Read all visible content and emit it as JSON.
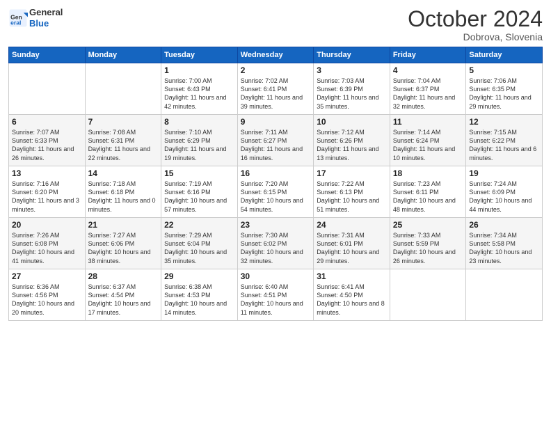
{
  "header": {
    "logo_general": "General",
    "logo_blue": "Blue",
    "month_title": "October 2024",
    "location": "Dobrova, Slovenia"
  },
  "days_of_week": [
    "Sunday",
    "Monday",
    "Tuesday",
    "Wednesday",
    "Thursday",
    "Friday",
    "Saturday"
  ],
  "weeks": [
    [
      {
        "day": "",
        "sunrise": "",
        "sunset": "",
        "daylight": ""
      },
      {
        "day": "",
        "sunrise": "",
        "sunset": "",
        "daylight": ""
      },
      {
        "day": "1",
        "sunrise": "Sunrise: 7:00 AM",
        "sunset": "Sunset: 6:43 PM",
        "daylight": "Daylight: 11 hours and 42 minutes."
      },
      {
        "day": "2",
        "sunrise": "Sunrise: 7:02 AM",
        "sunset": "Sunset: 6:41 PM",
        "daylight": "Daylight: 11 hours and 39 minutes."
      },
      {
        "day": "3",
        "sunrise": "Sunrise: 7:03 AM",
        "sunset": "Sunset: 6:39 PM",
        "daylight": "Daylight: 11 hours and 35 minutes."
      },
      {
        "day": "4",
        "sunrise": "Sunrise: 7:04 AM",
        "sunset": "Sunset: 6:37 PM",
        "daylight": "Daylight: 11 hours and 32 minutes."
      },
      {
        "day": "5",
        "sunrise": "Sunrise: 7:06 AM",
        "sunset": "Sunset: 6:35 PM",
        "daylight": "Daylight: 11 hours and 29 minutes."
      }
    ],
    [
      {
        "day": "6",
        "sunrise": "Sunrise: 7:07 AM",
        "sunset": "Sunset: 6:33 PM",
        "daylight": "Daylight: 11 hours and 26 minutes."
      },
      {
        "day": "7",
        "sunrise": "Sunrise: 7:08 AM",
        "sunset": "Sunset: 6:31 PM",
        "daylight": "Daylight: 11 hours and 22 minutes."
      },
      {
        "day": "8",
        "sunrise": "Sunrise: 7:10 AM",
        "sunset": "Sunset: 6:29 PM",
        "daylight": "Daylight: 11 hours and 19 minutes."
      },
      {
        "day": "9",
        "sunrise": "Sunrise: 7:11 AM",
        "sunset": "Sunset: 6:27 PM",
        "daylight": "Daylight: 11 hours and 16 minutes."
      },
      {
        "day": "10",
        "sunrise": "Sunrise: 7:12 AM",
        "sunset": "Sunset: 6:26 PM",
        "daylight": "Daylight: 11 hours and 13 minutes."
      },
      {
        "day": "11",
        "sunrise": "Sunrise: 7:14 AM",
        "sunset": "Sunset: 6:24 PM",
        "daylight": "Daylight: 11 hours and 10 minutes."
      },
      {
        "day": "12",
        "sunrise": "Sunrise: 7:15 AM",
        "sunset": "Sunset: 6:22 PM",
        "daylight": "Daylight: 11 hours and 6 minutes."
      }
    ],
    [
      {
        "day": "13",
        "sunrise": "Sunrise: 7:16 AM",
        "sunset": "Sunset: 6:20 PM",
        "daylight": "Daylight: 11 hours and 3 minutes."
      },
      {
        "day": "14",
        "sunrise": "Sunrise: 7:18 AM",
        "sunset": "Sunset: 6:18 PM",
        "daylight": "Daylight: 11 hours and 0 minutes."
      },
      {
        "day": "15",
        "sunrise": "Sunrise: 7:19 AM",
        "sunset": "Sunset: 6:16 PM",
        "daylight": "Daylight: 10 hours and 57 minutes."
      },
      {
        "day": "16",
        "sunrise": "Sunrise: 7:20 AM",
        "sunset": "Sunset: 6:15 PM",
        "daylight": "Daylight: 10 hours and 54 minutes."
      },
      {
        "day": "17",
        "sunrise": "Sunrise: 7:22 AM",
        "sunset": "Sunset: 6:13 PM",
        "daylight": "Daylight: 10 hours and 51 minutes."
      },
      {
        "day": "18",
        "sunrise": "Sunrise: 7:23 AM",
        "sunset": "Sunset: 6:11 PM",
        "daylight": "Daylight: 10 hours and 48 minutes."
      },
      {
        "day": "19",
        "sunrise": "Sunrise: 7:24 AM",
        "sunset": "Sunset: 6:09 PM",
        "daylight": "Daylight: 10 hours and 44 minutes."
      }
    ],
    [
      {
        "day": "20",
        "sunrise": "Sunrise: 7:26 AM",
        "sunset": "Sunset: 6:08 PM",
        "daylight": "Daylight: 10 hours and 41 minutes."
      },
      {
        "day": "21",
        "sunrise": "Sunrise: 7:27 AM",
        "sunset": "Sunset: 6:06 PM",
        "daylight": "Daylight: 10 hours and 38 minutes."
      },
      {
        "day": "22",
        "sunrise": "Sunrise: 7:29 AM",
        "sunset": "Sunset: 6:04 PM",
        "daylight": "Daylight: 10 hours and 35 minutes."
      },
      {
        "day": "23",
        "sunrise": "Sunrise: 7:30 AM",
        "sunset": "Sunset: 6:02 PM",
        "daylight": "Daylight: 10 hours and 32 minutes."
      },
      {
        "day": "24",
        "sunrise": "Sunrise: 7:31 AM",
        "sunset": "Sunset: 6:01 PM",
        "daylight": "Daylight: 10 hours and 29 minutes."
      },
      {
        "day": "25",
        "sunrise": "Sunrise: 7:33 AM",
        "sunset": "Sunset: 5:59 PM",
        "daylight": "Daylight: 10 hours and 26 minutes."
      },
      {
        "day": "26",
        "sunrise": "Sunrise: 7:34 AM",
        "sunset": "Sunset: 5:58 PM",
        "daylight": "Daylight: 10 hours and 23 minutes."
      }
    ],
    [
      {
        "day": "27",
        "sunrise": "Sunrise: 6:36 AM",
        "sunset": "Sunset: 4:56 PM",
        "daylight": "Daylight: 10 hours and 20 minutes."
      },
      {
        "day": "28",
        "sunrise": "Sunrise: 6:37 AM",
        "sunset": "Sunset: 4:54 PM",
        "daylight": "Daylight: 10 hours and 17 minutes."
      },
      {
        "day": "29",
        "sunrise": "Sunrise: 6:38 AM",
        "sunset": "Sunset: 4:53 PM",
        "daylight": "Daylight: 10 hours and 14 minutes."
      },
      {
        "day": "30",
        "sunrise": "Sunrise: 6:40 AM",
        "sunset": "Sunset: 4:51 PM",
        "daylight": "Daylight: 10 hours and 11 minutes."
      },
      {
        "day": "31",
        "sunrise": "Sunrise: 6:41 AM",
        "sunset": "Sunset: 4:50 PM",
        "daylight": "Daylight: 10 hours and 8 minutes."
      },
      {
        "day": "",
        "sunrise": "",
        "sunset": "",
        "daylight": ""
      },
      {
        "day": "",
        "sunrise": "",
        "sunset": "",
        "daylight": ""
      }
    ]
  ]
}
